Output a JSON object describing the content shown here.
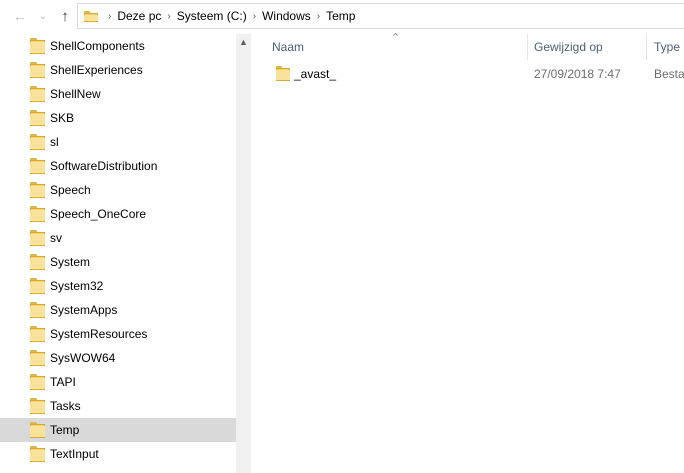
{
  "toolbar": {
    "back_icon": "arrow-left-icon",
    "recent_icon": "chevron-down-icon",
    "up_icon": "arrow-up-icon",
    "breadcrumb": [
      "Deze pc",
      "Systeem (C:)",
      "Windows",
      "Temp"
    ]
  },
  "tree": {
    "items": [
      {
        "label": "ShellComponents"
      },
      {
        "label": "ShellExperiences"
      },
      {
        "label": "ShellNew"
      },
      {
        "label": "SKB"
      },
      {
        "label": "sl"
      },
      {
        "label": "SoftwareDistribution"
      },
      {
        "label": "Speech"
      },
      {
        "label": "Speech_OneCore"
      },
      {
        "label": "sv"
      },
      {
        "label": "System"
      },
      {
        "label": "System32"
      },
      {
        "label": "SystemApps"
      },
      {
        "label": "SystemResources"
      },
      {
        "label": "SysWOW64"
      },
      {
        "label": "TAPI"
      },
      {
        "label": "Tasks"
      },
      {
        "label": "Temp",
        "selected": true
      },
      {
        "label": "TextInput"
      }
    ]
  },
  "list": {
    "columns": {
      "name": "Naam",
      "modified": "Gewijzigd op",
      "type": "Type"
    },
    "rows": [
      {
        "name": "_avast_",
        "modified": "27/09/2018 7:47",
        "type": "Bestan"
      }
    ]
  },
  "colors": {
    "selection": "#d9d9d9",
    "header_text": "#4c607a",
    "folder": "#f6d26b"
  }
}
